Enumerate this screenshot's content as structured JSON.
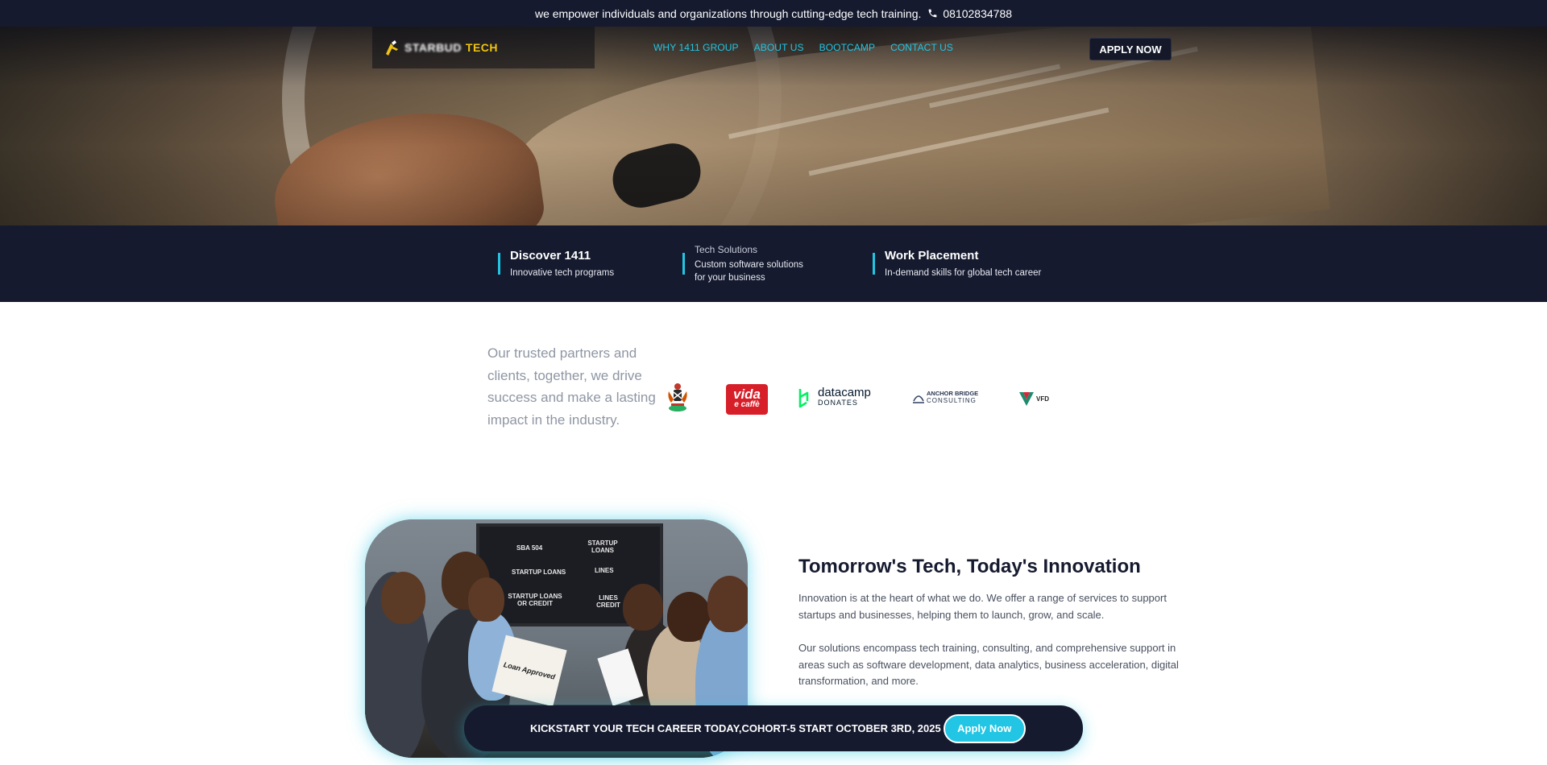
{
  "topbar": {
    "message": "we empower individuals and organizations through cutting-edge tech training.",
    "phone": "08102834788",
    "phone_icon": "phone-icon"
  },
  "nav": {
    "logo_text_blurred": "STARBUD",
    "logo_text": "TECH",
    "links": [
      "WHY 1411 GROUP",
      "ABOUT US",
      "BOOTCAMP",
      "CONTACT US"
    ],
    "apply_label": "APPLY NOW"
  },
  "features": [
    {
      "title": "Discover 1411",
      "desc": "Innovative tech programs"
    },
    {
      "title": "Tech Solutions",
      "desc_line1": "Custom software solutions",
      "desc_line2": "for your business"
    },
    {
      "title": "Work Placement",
      "desc": "In-demand skills for global tech career"
    }
  ],
  "partners": {
    "text": "Our trusted partners and clients, together, we drive success and make a lasting impact in the industry.",
    "logos": [
      {
        "name": "coat-of-arms",
        "text": ""
      },
      {
        "name": "vida-e-caffe",
        "text_1": "vida",
        "text_2": "e caffè"
      },
      {
        "name": "datacamp-donates",
        "text_1": "datacamp",
        "text_2": "DONATES"
      },
      {
        "name": "anchor-bridge-consulting",
        "text_1": "ANCHOR BRIDGE",
        "text_2": "CONSULTING"
      },
      {
        "name": "vfd",
        "text": "VFD"
      }
    ]
  },
  "photo": {
    "screen_lines": [
      "SBA 504",
      "STARTUP LOANS",
      "STARTUP LOANS",
      "LINES",
      "STARTUP LOANS OR CREDIT",
      "LINES CREDIT"
    ],
    "paper_text": "Loan Approved"
  },
  "content": {
    "title": "Tomorrow's Tech, Today's Innovation",
    "para1": "Innovation is at the heart of what we do. We offer a range of services to support startups and businesses, helping them to launch, grow, and scale.",
    "para2": "Our solutions encompass tech training, consulting, and comprehensive support in areas such as software development, data analytics, business acceleration, digital transformation, and more."
  },
  "cta": {
    "text": "KICKSTART YOUR TECH CAREER TODAY,COHORT-5 START OCTOBER 3RD, 2025",
    "button": "Apply Now"
  },
  "colors": {
    "navy": "#151a2f",
    "accent": "#22c5e3",
    "logo_yellow": "#f1c40f"
  }
}
